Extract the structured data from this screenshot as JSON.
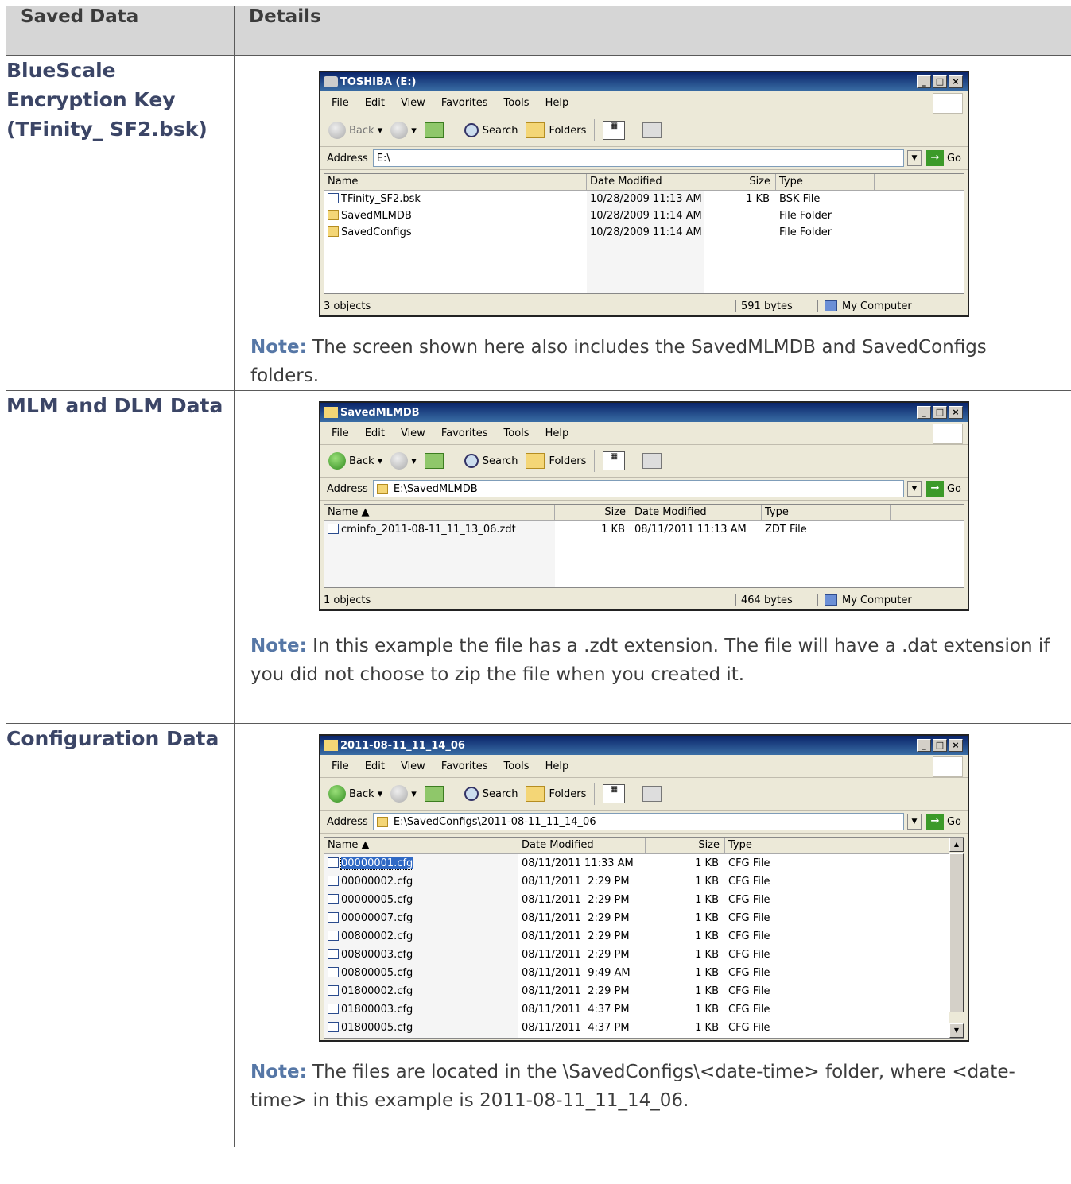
{
  "table": {
    "col1_header": "Saved Data",
    "col2_header": "Details"
  },
  "row1": {
    "label": "BlueScale Encryption Key (TFinity_ SF2.bsk)",
    "window": {
      "title": "TOSHIBA (E:)",
      "menu": [
        "File",
        "Edit",
        "View",
        "Favorites",
        "Tools",
        "Help"
      ],
      "back_label": "Back",
      "search_label": "Search",
      "folders_label": "Folders",
      "address_label": "Address",
      "address_value": "E:\\",
      "go_label": "Go",
      "columns": [
        "Name",
        "Date Modified",
        "Size",
        "Type"
      ],
      "rows": [
        {
          "name": "TFinity_SF2.bsk",
          "date": "10/28/2009 11:13 AM",
          "size": "1 KB",
          "type": "BSK File",
          "icon": "file"
        },
        {
          "name": "SavedMLMDB",
          "date": "10/28/2009 11:14 AM",
          "size": "",
          "type": "File Folder",
          "icon": "folder"
        },
        {
          "name": "SavedConfigs",
          "date": "10/28/2009 11:14 AM",
          "size": "",
          "type": "File Folder",
          "icon": "folder"
        }
      ],
      "status_objects": "3 objects",
      "status_bytes": "591 bytes",
      "status_location": "My Computer"
    },
    "note_label": "Note:",
    "note_text": " The screen shown here also includes the SavedMLMDB and SavedConfigs folders."
  },
  "row2": {
    "label": "MLM and DLM Data",
    "window": {
      "title": "SavedMLMDB",
      "menu": [
        "File",
        "Edit",
        "View",
        "Favorites",
        "Tools",
        "Help"
      ],
      "back_label": "Back",
      "search_label": "Search",
      "folders_label": "Folders",
      "address_label": "Address",
      "address_value": "E:\\SavedMLMDB",
      "go_label": "Go",
      "columns": [
        "Name",
        "Size",
        "Date Modified",
        "Type"
      ],
      "rows": [
        {
          "name": "cminfo_2011-08-11_11_13_06.zdt",
          "size": "1 KB",
          "date": "08/11/2011 11:13 AM",
          "type": "ZDT File"
        }
      ],
      "status_objects": "1 objects",
      "status_bytes": "464 bytes",
      "status_location": "My Computer"
    },
    "note_label": "Note:",
    "note_text": " In this example the file has a .zdt extension. The file will have a .dat extension if you did not choose to zip the file when you created it."
  },
  "row3": {
    "label": "Configuration Data",
    "window": {
      "title": "2011-08-11_11_14_06",
      "menu": [
        "File",
        "Edit",
        "View",
        "Favorites",
        "Tools",
        "Help"
      ],
      "back_label": "Back",
      "search_label": "Search",
      "folders_label": "Folders",
      "address_label": "Address",
      "address_value": "E:\\SavedConfigs\\2011-08-11_11_14_06",
      "go_label": "Go",
      "columns": [
        "Name",
        "Date Modified",
        "Size",
        "Type"
      ],
      "rows": [
        {
          "name": "00000001.cfg",
          "date": "08/11/2011 11:33 AM",
          "size": "1 KB",
          "type": "CFG File"
        },
        {
          "name": "00000002.cfg",
          "date": "08/11/2011  2:29 PM",
          "size": "1 KB",
          "type": "CFG File"
        },
        {
          "name": "00000005.cfg",
          "date": "08/11/2011  2:29 PM",
          "size": "1 KB",
          "type": "CFG File"
        },
        {
          "name": "00000007.cfg",
          "date": "08/11/2011  2:29 PM",
          "size": "1 KB",
          "type": "CFG File"
        },
        {
          "name": "00800002.cfg",
          "date": "08/11/2011  2:29 PM",
          "size": "1 KB",
          "type": "CFG File"
        },
        {
          "name": "00800003.cfg",
          "date": "08/11/2011  2:29 PM",
          "size": "1 KB",
          "type": "CFG File"
        },
        {
          "name": "00800005.cfg",
          "date": "08/11/2011  9:49 AM",
          "size": "1 KB",
          "type": "CFG File"
        },
        {
          "name": "01800002.cfg",
          "date": "08/11/2011  2:29 PM",
          "size": "1 KB",
          "type": "CFG File"
        },
        {
          "name": "01800003.cfg",
          "date": "08/11/2011  4:37 PM",
          "size": "1 KB",
          "type": "CFG File"
        },
        {
          "name": "01800005.cfg",
          "date": "08/11/2011  4:37 PM",
          "size": "1 KB",
          "type": "CFG File"
        }
      ]
    },
    "note_label": "Note:",
    "note_text": " The files are located in the \\SavedConfigs\\<date-time> folder, where <date-time> in this example is 2011-08-11_11_14_06."
  }
}
